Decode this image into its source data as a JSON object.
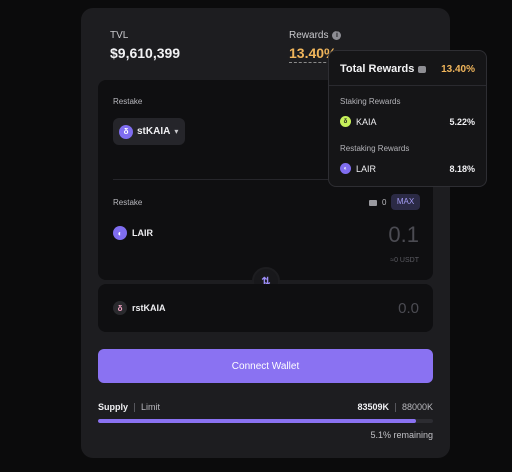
{
  "stats": {
    "tvl_label": "TVL",
    "tvl_value": "$9,610,399",
    "rewards_label": "Rewards",
    "rewards_value": "13.40%"
  },
  "restake": {
    "label": "Restake",
    "token": "stKAIA",
    "token_icon": "kaia-drop-icon"
  },
  "receive": {
    "label": "Restake",
    "balance": "0",
    "max_label": "MAX",
    "token": "LAIR",
    "amount": "0.1",
    "usd": "≈0 USDT"
  },
  "output": {
    "token": "rstKAIA",
    "amount": "0.0"
  },
  "connect_label": "Connect Wallet",
  "supply": {
    "tab_supply": "Supply",
    "tab_limit": "Limit",
    "current": "83509K",
    "max": "88000K",
    "fill_fraction": 0.949,
    "remaining": "5.1% remaining"
  },
  "tooltip": {
    "title": "Total Rewards",
    "total": "13.40%",
    "staking_label": "Staking Rewards",
    "staking_token": "KAIA",
    "staking_value": "5.22%",
    "restaking_label": "Restaking Rewards",
    "restaking_token": "LAIR",
    "restaking_value": "8.18%"
  },
  "colors": {
    "accent": "#8a72f2",
    "rewards": "#f0b55b",
    "background": "#0b0b0c",
    "card": "#1d1d20"
  }
}
